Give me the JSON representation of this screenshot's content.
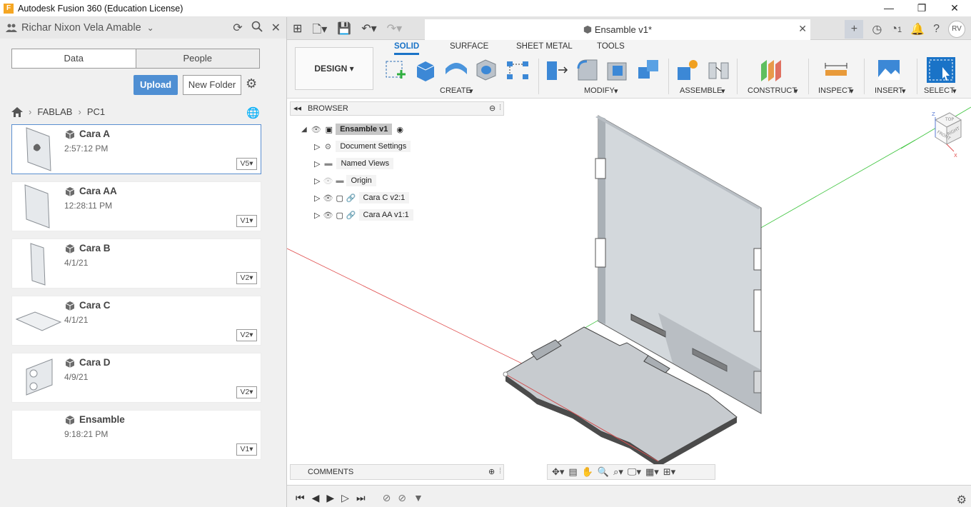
{
  "window": {
    "logo": "F",
    "title": "Autodesk Fusion 360 (Education License)",
    "controls": [
      "—",
      "❐",
      "✕"
    ]
  },
  "data_panel": {
    "user": "Richar Nixon Vela Amable",
    "tabs": [
      "Data",
      "People"
    ],
    "upload_label": "Upload",
    "new_folder_label": "New Folder",
    "breadcrumb": [
      "FABLAB",
      "PC1"
    ],
    "files": [
      {
        "name": "Cara A",
        "date": "2:57:12 PM",
        "version": "V5",
        "selected": true
      },
      {
        "name": "Cara AA",
        "date": "12:28:11 PM",
        "version": "V1"
      },
      {
        "name": "Cara B",
        "date": "4/1/21",
        "version": "V2"
      },
      {
        "name": "Cara C",
        "date": "4/1/21",
        "version": "V2"
      },
      {
        "name": "Cara D",
        "date": "4/9/21",
        "version": "V2"
      },
      {
        "name": "Ensamble",
        "date": "9:18:21 PM",
        "version": "V1"
      }
    ]
  },
  "appbar": {
    "doc_title": "Ensamble v1*",
    "job_count": "1",
    "user_initials": "RV"
  },
  "ribbon": {
    "workspace": "DESIGN",
    "tabs": [
      "SOLID",
      "SURFACE",
      "SHEET METAL",
      "TOOLS"
    ],
    "active_tab": "SOLID",
    "groups": [
      "CREATE",
      "MODIFY",
      "ASSEMBLE",
      "CONSTRUCT",
      "INSPECT",
      "INSERT",
      "SELECT"
    ]
  },
  "browser": {
    "title": "BROWSER",
    "root": "Ensamble v1",
    "items": [
      "Document Settings",
      "Named Views",
      "Origin",
      "Cara C v2:1",
      "Cara AA v1:1"
    ]
  },
  "comments": {
    "title": "COMMENTS"
  },
  "viewcube": {
    "faces": [
      "TOP",
      "FRONT",
      "RIGHT"
    ],
    "axes": [
      "Z",
      "X"
    ]
  },
  "colors": {
    "accent": "#1a73c7",
    "upload": "#4f8fd3",
    "x_axis": "#e05050",
    "y_axis": "#3cc43c"
  }
}
